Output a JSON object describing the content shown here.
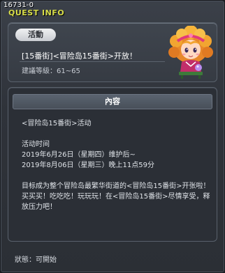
{
  "window": {
    "quest_id": "16731-0",
    "title": "QUEST INFO"
  },
  "quest": {
    "tag": "活動",
    "title": "[15番街]<冒险岛15番街>开放！",
    "level": "建議等級：61~65"
  },
  "content": {
    "header": "內容",
    "lines": [
      "<冒险岛15番街>活动",
      "",
      "活动时间",
      "2019年6月26日（星期四）维护后~",
      "2019年8月06日（星期三）晚上11点59分",
      "",
      "目标成为整个冒险岛最繁华街道的<冒险岛15番街>开张啦！买买买！吃吃吃！玩玩玩！在<冒险岛15番街>尽情享受，释放压力吧！"
    ]
  },
  "status": {
    "text": "狀態：可開始"
  },
  "npc": {
    "icon": "npc-girl-portrait-icon"
  },
  "colors": {
    "title": "#d8dd48",
    "panel_border": "#59616c",
    "text": "#ffffff"
  }
}
